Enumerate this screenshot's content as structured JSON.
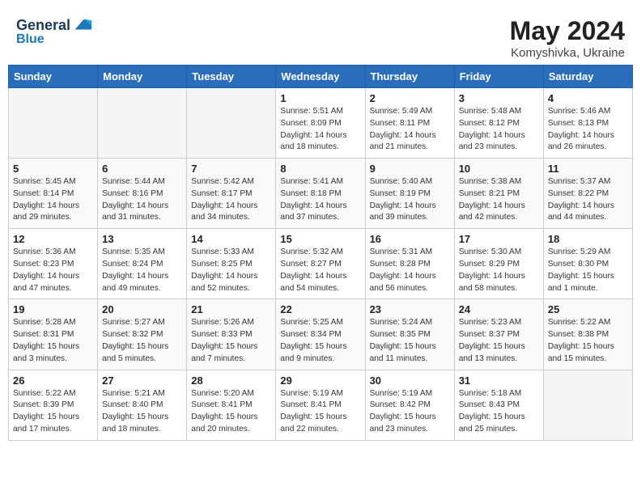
{
  "header": {
    "logo_line1": "General",
    "logo_line2": "Blue",
    "month_year": "May 2024",
    "location": "Komyshivka, Ukraine"
  },
  "days_of_week": [
    "Sunday",
    "Monday",
    "Tuesday",
    "Wednesday",
    "Thursday",
    "Friday",
    "Saturday"
  ],
  "weeks": [
    [
      {
        "day": "",
        "info": ""
      },
      {
        "day": "",
        "info": ""
      },
      {
        "day": "",
        "info": ""
      },
      {
        "day": "1",
        "info": "Sunrise: 5:51 AM\nSunset: 8:09 PM\nDaylight: 14 hours\nand 18 minutes."
      },
      {
        "day": "2",
        "info": "Sunrise: 5:49 AM\nSunset: 8:11 PM\nDaylight: 14 hours\nand 21 minutes."
      },
      {
        "day": "3",
        "info": "Sunrise: 5:48 AM\nSunset: 8:12 PM\nDaylight: 14 hours\nand 23 minutes."
      },
      {
        "day": "4",
        "info": "Sunrise: 5:46 AM\nSunset: 8:13 PM\nDaylight: 14 hours\nand 26 minutes."
      }
    ],
    [
      {
        "day": "5",
        "info": "Sunrise: 5:45 AM\nSunset: 8:14 PM\nDaylight: 14 hours\nand 29 minutes."
      },
      {
        "day": "6",
        "info": "Sunrise: 5:44 AM\nSunset: 8:16 PM\nDaylight: 14 hours\nand 31 minutes."
      },
      {
        "day": "7",
        "info": "Sunrise: 5:42 AM\nSunset: 8:17 PM\nDaylight: 14 hours\nand 34 minutes."
      },
      {
        "day": "8",
        "info": "Sunrise: 5:41 AM\nSunset: 8:18 PM\nDaylight: 14 hours\nand 37 minutes."
      },
      {
        "day": "9",
        "info": "Sunrise: 5:40 AM\nSunset: 8:19 PM\nDaylight: 14 hours\nand 39 minutes."
      },
      {
        "day": "10",
        "info": "Sunrise: 5:38 AM\nSunset: 8:21 PM\nDaylight: 14 hours\nand 42 minutes."
      },
      {
        "day": "11",
        "info": "Sunrise: 5:37 AM\nSunset: 8:22 PM\nDaylight: 14 hours\nand 44 minutes."
      }
    ],
    [
      {
        "day": "12",
        "info": "Sunrise: 5:36 AM\nSunset: 8:23 PM\nDaylight: 14 hours\nand 47 minutes."
      },
      {
        "day": "13",
        "info": "Sunrise: 5:35 AM\nSunset: 8:24 PM\nDaylight: 14 hours\nand 49 minutes."
      },
      {
        "day": "14",
        "info": "Sunrise: 5:33 AM\nSunset: 8:25 PM\nDaylight: 14 hours\nand 52 minutes."
      },
      {
        "day": "15",
        "info": "Sunrise: 5:32 AM\nSunset: 8:27 PM\nDaylight: 14 hours\nand 54 minutes."
      },
      {
        "day": "16",
        "info": "Sunrise: 5:31 AM\nSunset: 8:28 PM\nDaylight: 14 hours\nand 56 minutes."
      },
      {
        "day": "17",
        "info": "Sunrise: 5:30 AM\nSunset: 8:29 PM\nDaylight: 14 hours\nand 58 minutes."
      },
      {
        "day": "18",
        "info": "Sunrise: 5:29 AM\nSunset: 8:30 PM\nDaylight: 15 hours\nand 1 minute."
      }
    ],
    [
      {
        "day": "19",
        "info": "Sunrise: 5:28 AM\nSunset: 8:31 PM\nDaylight: 15 hours\nand 3 minutes."
      },
      {
        "day": "20",
        "info": "Sunrise: 5:27 AM\nSunset: 8:32 PM\nDaylight: 15 hours\nand 5 minutes."
      },
      {
        "day": "21",
        "info": "Sunrise: 5:26 AM\nSunset: 8:33 PM\nDaylight: 15 hours\nand 7 minutes."
      },
      {
        "day": "22",
        "info": "Sunrise: 5:25 AM\nSunset: 8:34 PM\nDaylight: 15 hours\nand 9 minutes."
      },
      {
        "day": "23",
        "info": "Sunrise: 5:24 AM\nSunset: 8:35 PM\nDaylight: 15 hours\nand 11 minutes."
      },
      {
        "day": "24",
        "info": "Sunrise: 5:23 AM\nSunset: 8:37 PM\nDaylight: 15 hours\nand 13 minutes."
      },
      {
        "day": "25",
        "info": "Sunrise: 5:22 AM\nSunset: 8:38 PM\nDaylight: 15 hours\nand 15 minutes."
      }
    ],
    [
      {
        "day": "26",
        "info": "Sunrise: 5:22 AM\nSunset: 8:39 PM\nDaylight: 15 hours\nand 17 minutes."
      },
      {
        "day": "27",
        "info": "Sunrise: 5:21 AM\nSunset: 8:40 PM\nDaylight: 15 hours\nand 18 minutes."
      },
      {
        "day": "28",
        "info": "Sunrise: 5:20 AM\nSunset: 8:41 PM\nDaylight: 15 hours\nand 20 minutes."
      },
      {
        "day": "29",
        "info": "Sunrise: 5:19 AM\nSunset: 8:41 PM\nDaylight: 15 hours\nand 22 minutes."
      },
      {
        "day": "30",
        "info": "Sunrise: 5:19 AM\nSunset: 8:42 PM\nDaylight: 15 hours\nand 23 minutes."
      },
      {
        "day": "31",
        "info": "Sunrise: 5:18 AM\nSunset: 8:43 PM\nDaylight: 15 hours\nand 25 minutes."
      },
      {
        "day": "",
        "info": ""
      }
    ]
  ]
}
